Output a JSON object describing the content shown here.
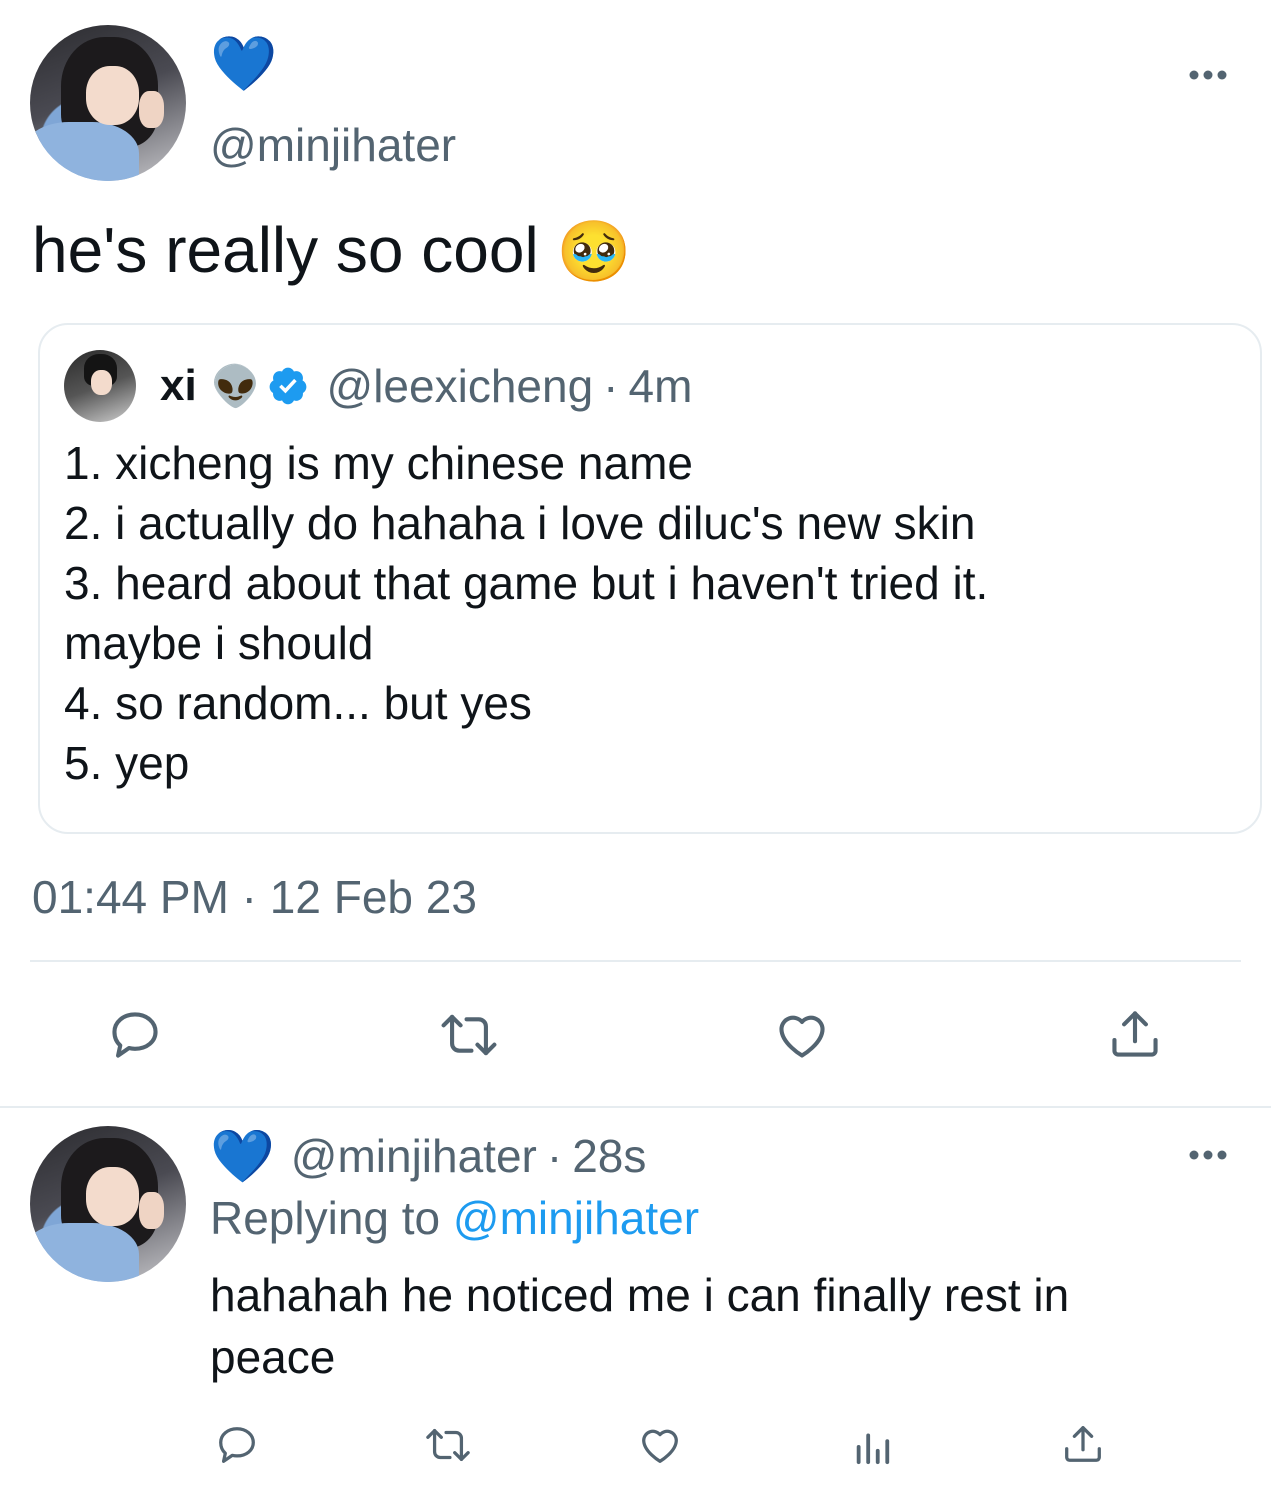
{
  "main_tweet": {
    "display_name_emoji": "💙",
    "handle": "@minjihater",
    "text": "he's really so cool",
    "text_emoji": "🥹",
    "timestamp": "01:44 PM · 12 Feb 23"
  },
  "quoted_tweet": {
    "name": "xi",
    "name_emoji": "👽",
    "handle": "@leexicheng",
    "separator": "·",
    "time": "4m",
    "lines": [
      "1. xicheng is my chinese name",
      "2. i actually do hahaha i love diluc's new skin",
      "3. heard about that game but i haven't tried it.",
      "maybe i should",
      "4. so random... but yes",
      "5. yep"
    ]
  },
  "reply_tweet": {
    "display_name_emoji": "💙",
    "handle": "@minjihater",
    "separator": "·",
    "time": "28s",
    "replying_prefix": "Replying to",
    "replying_to": "@minjihater",
    "text_line1": "hahahah he noticed me i can finally rest in",
    "text_line2": "peace"
  },
  "colors": {
    "accent": "#1d9bf0",
    "muted": "#536471",
    "border": "#e6ecf0",
    "icon": "#536471"
  },
  "icons": {
    "more": "more-icon",
    "reply": "reply-icon",
    "retweet": "retweet-icon",
    "like": "like-icon",
    "share": "share-icon",
    "analytics": "analytics-icon",
    "verified": "verified-badge-icon"
  }
}
